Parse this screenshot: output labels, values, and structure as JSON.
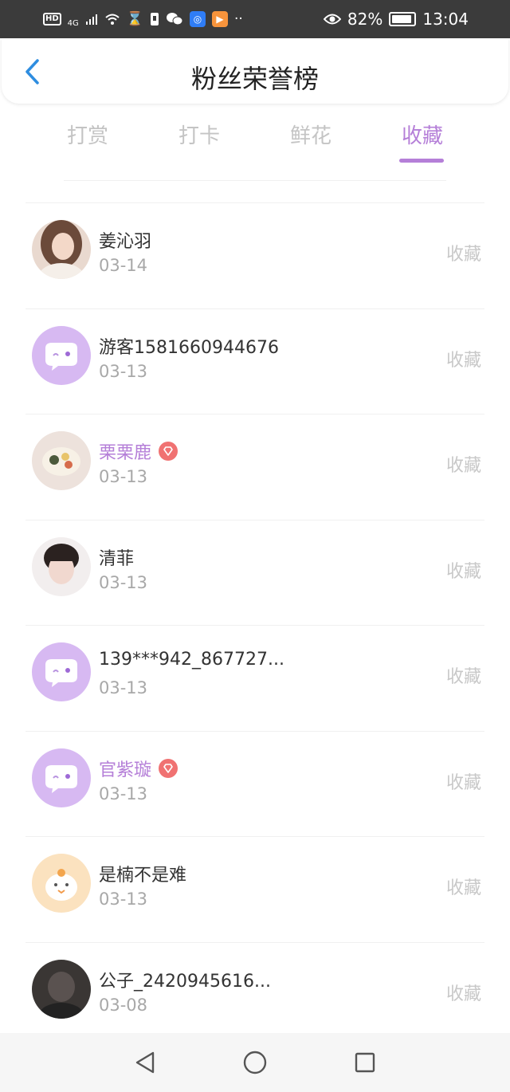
{
  "status_bar": {
    "network": "4G",
    "battery": "82%",
    "time": "13:04",
    "left_icons": [
      "hd-icon",
      "signal-icon",
      "wifi-icon",
      "hourglass-icon",
      "sim-icon",
      "wechat-icon",
      "app-icon-blue",
      "app-icon-orange",
      "more-dots-icon"
    ],
    "right_icons": [
      "eye-icon",
      "battery-icon"
    ]
  },
  "header": {
    "title": "粉丝荣誉榜",
    "back_icon": "chevron-left-icon"
  },
  "tabs": [
    {
      "label": "打赏"
    },
    {
      "label": "打卡"
    },
    {
      "label": "鲜花"
    },
    {
      "label": "收藏",
      "active": true
    }
  ],
  "colors": {
    "accent": "#b57fd8",
    "vip_badge": "#f07272",
    "tab_inactive": "#c4c4c4",
    "date": "#a8a8a8"
  },
  "fans": [
    {
      "name": "姜沁羽",
      "date": "03-14",
      "action": "收藏",
      "vip": false,
      "avatar": "photo-girl-avatar"
    },
    {
      "name": "游客1581660944676",
      "date": "03-13",
      "action": "收藏",
      "vip": false,
      "avatar": "default-chat-avatar"
    },
    {
      "name": "栗栗鹿",
      "date": "03-13",
      "action": "收藏",
      "vip": true,
      "avatar": "food-avatar"
    },
    {
      "name": "清菲",
      "date": "03-13",
      "action": "收藏",
      "vip": false,
      "avatar": "photo-boy-avatar"
    },
    {
      "name": "139***942_867727...",
      "date": "03-13",
      "action": "收藏",
      "vip": false,
      "avatar": "default-chat-avatar"
    },
    {
      "name": "官紫璇",
      "date": "03-13",
      "action": "收藏",
      "vip": true,
      "avatar": "default-chat-avatar"
    },
    {
      "name": "是楠不是难",
      "date": "03-13",
      "action": "收藏",
      "vip": false,
      "avatar": "cartoon-chick-avatar"
    },
    {
      "name": "公子_2420945616...",
      "date": "03-08",
      "action": "收藏",
      "vip": false,
      "avatar": "dark-photo-avatar"
    }
  ],
  "nav_bar": {
    "icons": [
      "back-triangle-icon",
      "home-circle-icon",
      "recents-square-icon"
    ]
  }
}
